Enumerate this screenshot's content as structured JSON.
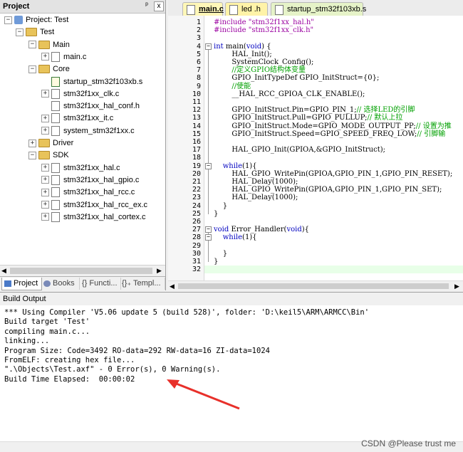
{
  "project_panel": {
    "title": "Project",
    "pin_icon": "pin-icon",
    "close_label": "x",
    "tree": [
      {
        "label": "Project: Test",
        "indent": 0,
        "kind": "project",
        "expander": "−"
      },
      {
        "label": "Test",
        "indent": 1,
        "kind": "target",
        "expander": "−"
      },
      {
        "label": "Main",
        "indent": 2,
        "kind": "folder",
        "expander": "−"
      },
      {
        "label": "main.c",
        "indent": 3,
        "kind": "file",
        "expander": "+"
      },
      {
        "label": "Core",
        "indent": 2,
        "kind": "folder",
        "expander": "−"
      },
      {
        "label": "startup_stm32f103xb.s",
        "indent": 3,
        "kind": "gearfile",
        "expander": ""
      },
      {
        "label": "stm32f1xx_clk.c",
        "indent": 3,
        "kind": "file",
        "expander": "+"
      },
      {
        "label": "stm32f1xx_hal_conf.h",
        "indent": 3,
        "kind": "file",
        "expander": ""
      },
      {
        "label": "stm32f1xx_it.c",
        "indent": 3,
        "kind": "file",
        "expander": "+"
      },
      {
        "label": "system_stm32f1xx.c",
        "indent": 3,
        "kind": "file",
        "expander": "+"
      },
      {
        "label": "Driver",
        "indent": 2,
        "kind": "folder",
        "expander": "+"
      },
      {
        "label": "SDK",
        "indent": 2,
        "kind": "folder",
        "expander": "−"
      },
      {
        "label": "stm32f1xx_hal.c",
        "indent": 3,
        "kind": "file",
        "expander": "+"
      },
      {
        "label": "stm32f1xx_hal_gpio.c",
        "indent": 3,
        "kind": "file",
        "expander": "+"
      },
      {
        "label": "stm32f1xx_hal_rcc.c",
        "indent": 3,
        "kind": "file",
        "expander": "+"
      },
      {
        "label": "stm32f1xx_hal_rcc_ex.c",
        "indent": 3,
        "kind": "file",
        "expander": "+"
      },
      {
        "label": "stm32f1xx_hal_cortex.c",
        "indent": 3,
        "kind": "file",
        "expander": "+"
      }
    ],
    "bottom_tabs": [
      "Project",
      "Books",
      "{} Functi...",
      "{}₊ Templ..."
    ]
  },
  "editor_tabs": [
    {
      "label": "main.c",
      "active": true,
      "color": "#fff7b8"
    },
    {
      "label": "led .h",
      "active": false,
      "color": "#fff3a8"
    },
    {
      "label": "startup_stm32f103xb.s",
      "active": false,
      "color": "#e6f3c8"
    }
  ],
  "editor": {
    "current_line": 32,
    "lines": [
      {
        "n": "1",
        "segments": [
          {
            "t": "#include ",
            "c": "str"
          },
          {
            "t": "\"stm32f1xx_hal.h\"",
            "c": "str"
          }
        ]
      },
      {
        "n": "2",
        "segments": [
          {
            "t": "#include ",
            "c": "str"
          },
          {
            "t": "\"stm32f1xx_clk.h\"",
            "c": "str"
          }
        ]
      },
      {
        "n": "3",
        "segments": []
      },
      {
        "n": "4",
        "segments": [
          {
            "t": "int",
            "c": "kw"
          },
          {
            "t": " main(",
            "c": ""
          },
          {
            "t": "void",
            "c": "kw"
          },
          {
            "t": ") {",
            "c": ""
          }
        ]
      },
      {
        "n": "5",
        "segments": [
          {
            "t": "        HAL_Init();",
            "c": ""
          }
        ]
      },
      {
        "n": "6",
        "segments": [
          {
            "t": "        SystemClock_Config();",
            "c": ""
          }
        ]
      },
      {
        "n": "7",
        "segments": [
          {
            "t": "        //定义GPIO结构体变量",
            "c": "cmt"
          }
        ]
      },
      {
        "n": "8",
        "segments": [
          {
            "t": "        GPIO_InitTypeDef GPIO_InitStruct={0};",
            "c": ""
          }
        ]
      },
      {
        "n": "9",
        "segments": [
          {
            "t": "        //使能",
            "c": "cmt"
          }
        ]
      },
      {
        "n": "10",
        "segments": [
          {
            "t": "        __HAL_RCC_GPIOA_CLK_ENABLE();",
            "c": ""
          }
        ]
      },
      {
        "n": "11",
        "segments": []
      },
      {
        "n": "12",
        "segments": [
          {
            "t": "        GPIO_InitStruct.Pin=GPIO_PIN_1;",
            "c": ""
          },
          {
            "t": "// 选择LED的引脚",
            "c": "cmt"
          }
        ]
      },
      {
        "n": "13",
        "segments": [
          {
            "t": "        GPIO_InitStruct.Pull=GPIO_PULLUP;",
            "c": ""
          },
          {
            "t": "// 默认上拉",
            "c": "cmt"
          }
        ]
      },
      {
        "n": "14",
        "segments": [
          {
            "t": "        GPIO_InitStruct.Mode=GPIO_MODE_OUTPUT_PP;",
            "c": ""
          },
          {
            "t": "// 设置为推",
            "c": "cmt"
          }
        ]
      },
      {
        "n": "15",
        "segments": [
          {
            "t": "        GPIO_InitStruct.Speed=GPIO_SPEED_FREQ_LOW;",
            "c": ""
          },
          {
            "t": "// 引脚输",
            "c": "cmt"
          }
        ]
      },
      {
        "n": "16",
        "segments": []
      },
      {
        "n": "17",
        "segments": [
          {
            "t": "        HAL_GPIO_Init(GPIOA,&GPIO_InitStruct);",
            "c": ""
          }
        ]
      },
      {
        "n": "18",
        "segments": []
      },
      {
        "n": "19",
        "segments": [
          {
            "t": "    ",
            "c": ""
          },
          {
            "t": "while",
            "c": "kw"
          },
          {
            "t": "(1){",
            "c": ""
          }
        ]
      },
      {
        "n": "20",
        "segments": [
          {
            "t": "        HAL_GPIO_WritePin(GPIOA,GPIO_PIN_1,GPIO_PIN_RESET);",
            "c": ""
          }
        ]
      },
      {
        "n": "21",
        "segments": [
          {
            "t": "        HAL_Delay(1000);",
            "c": ""
          }
        ]
      },
      {
        "n": "22",
        "segments": [
          {
            "t": "        HAL_GPIO_WritePin(GPIOA,GPIO_PIN_1,GPIO_PIN_SET);",
            "c": ""
          }
        ]
      },
      {
        "n": "23",
        "segments": [
          {
            "t": "        HAL_Delay(1000);",
            "c": ""
          }
        ]
      },
      {
        "n": "24",
        "segments": [
          {
            "t": "    }",
            "c": ""
          }
        ]
      },
      {
        "n": "25",
        "segments": [
          {
            "t": "}",
            "c": ""
          }
        ]
      },
      {
        "n": "26",
        "segments": []
      },
      {
        "n": "27",
        "segments": [
          {
            "t": "void",
            "c": "kw"
          },
          {
            "t": " Error_Handler(",
            "c": ""
          },
          {
            "t": "void",
            "c": "kw"
          },
          {
            "t": "){",
            "c": ""
          }
        ]
      },
      {
        "n": "28",
        "segments": [
          {
            "t": "    ",
            "c": ""
          },
          {
            "t": "while",
            "c": "kw"
          },
          {
            "t": "(1){",
            "c": ""
          }
        ]
      },
      {
        "n": "29",
        "segments": []
      },
      {
        "n": "30",
        "segments": [
          {
            "t": "    }",
            "c": ""
          }
        ]
      },
      {
        "n": "31",
        "segments": [
          {
            "t": "}",
            "c": ""
          }
        ]
      },
      {
        "n": "32",
        "segments": []
      }
    ]
  },
  "build_output": {
    "title": "Build Output",
    "lines": [
      "*** Using Compiler 'V5.06 update 5 (build 528)', folder: 'D:\\keil5\\ARM\\ARMCC\\Bin'",
      "Build target 'Test'",
      "compiling main.c...",
      "linking...",
      "Program Size: Code=3492 RO-data=292 RW-data=16 ZI-data=1024",
      "FromELF: creating hex file...",
      "\".\\Objects\\Test.axf\" - 0 Error(s), 0 Warning(s).",
      "Build Time Elapsed:  00:00:02"
    ],
    "arrow_color": "#e8302a"
  },
  "watermark": "CSDN @Please trust me"
}
